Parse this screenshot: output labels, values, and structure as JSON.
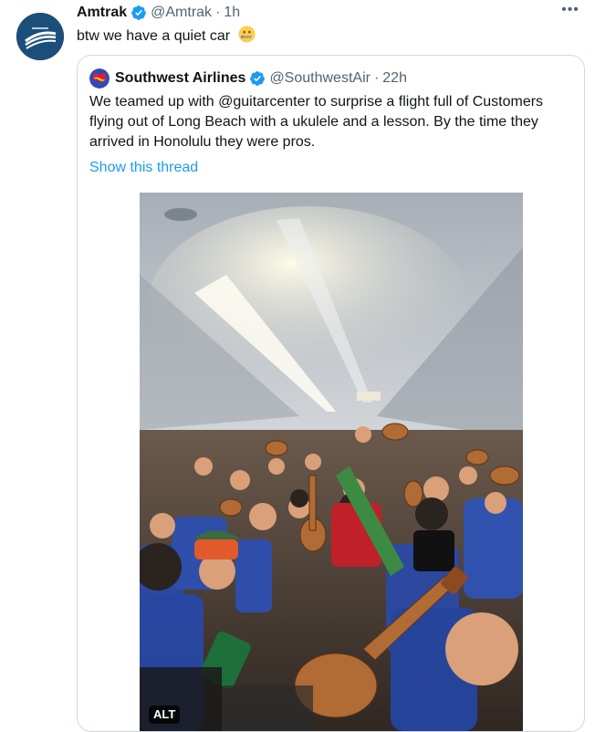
{
  "tweet": {
    "author_name": "Amtrak",
    "author_handle": "@Amtrak",
    "separator": "·",
    "time": "1h",
    "text": "btw we have a quiet car",
    "emoji_icon": "zipper-mouth-face-icon",
    "more_icon": "more-icon",
    "more_label": "•••"
  },
  "quoted_tweet": {
    "author_name": "Southwest Airlines",
    "author_handle": "@SouthwestAir",
    "separator": "·",
    "time": "22h",
    "text_lines": [
      "We teamed up with @guitarcenter to surprise a flight full of Customers",
      "flying out of Long Beach with a ukulele and a lesson. By the time they",
      "arrived in Honolulu they were pros."
    ],
    "show_thread_label": "Show this thread",
    "media_alt_badge": "ALT"
  },
  "colors": {
    "text": "#0f1419",
    "secondary": "#536471",
    "link": "#1d9bf0",
    "verified": "#1d9bf0",
    "border": "#cfd9de",
    "amtrak_blue": "#1b4f7a",
    "southwest_blue": "#304cb2"
  }
}
